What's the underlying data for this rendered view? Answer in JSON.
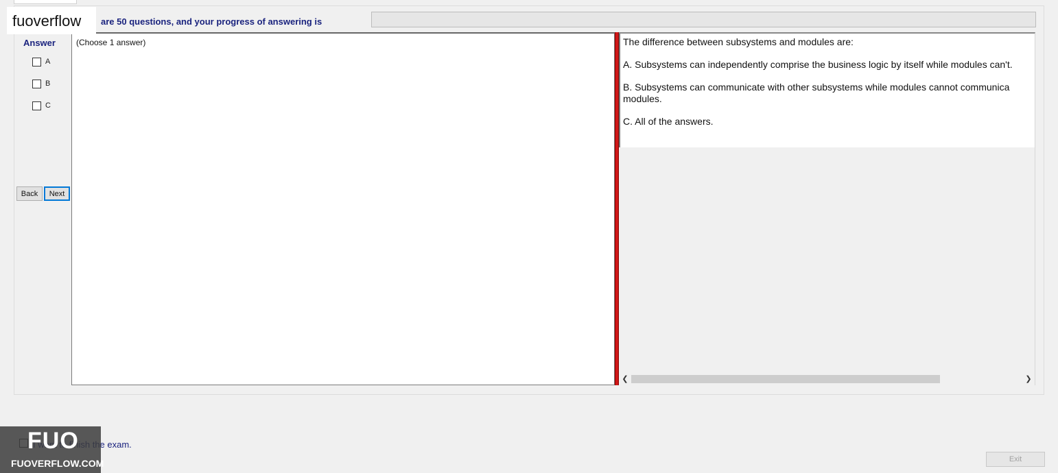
{
  "watermark": {
    "tag": "fuoverflow",
    "logo_big": "FUO",
    "logo_small": "FUOVERFLOW.COM"
  },
  "header": {
    "progress_text": "are 50 questions, and your progress of answering is",
    "progress_fraction": 0
  },
  "answer_panel": {
    "title": "Answer",
    "options": [
      {
        "label": "A"
      },
      {
        "label": "B"
      },
      {
        "label": "C"
      }
    ],
    "back_label": "Back",
    "next_label": "Next"
  },
  "left_pane": {
    "instruction": "(Choose 1 answer)"
  },
  "question": {
    "text": "The difference between subsystems and modules are:",
    "answers": [
      {
        "line1": "A.  Subsystems can independently comprise the business logic by itself while modules can't."
      },
      {
        "line1": "B.  Subsystems can communicate with other subsystems while modules cannot communica",
        "line2": "modules."
      },
      {
        "line1": "C.  All of the answers."
      }
    ]
  },
  "scrollbar": {
    "left_icon": "chevron-left-icon",
    "right_icon": "chevron-right-icon"
  },
  "footer": {
    "finish_label": "I want to finish the exam.",
    "exit_label": "Exit"
  },
  "colors": {
    "accent_text": "#1a237e",
    "splitter": "#d01818",
    "focus": "#0078d7"
  }
}
